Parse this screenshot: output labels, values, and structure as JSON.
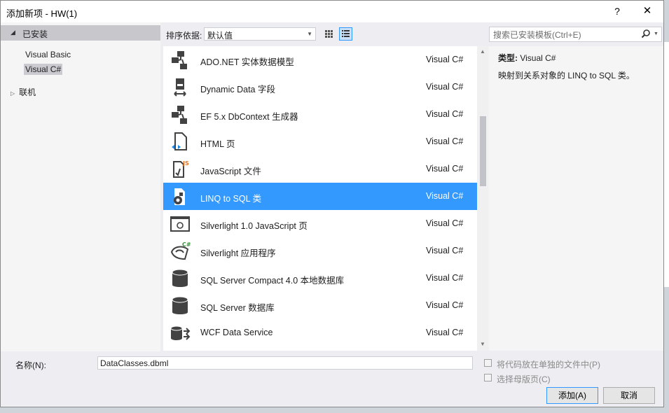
{
  "dialog": {
    "title": "添加新项 - HW(1)",
    "help_glyph": "?",
    "close_glyph": "✕"
  },
  "tree": {
    "installed_label": "已安装",
    "items": [
      {
        "label": "Visual Basic",
        "selected": false
      },
      {
        "label": "Visual C#",
        "selected": true
      }
    ],
    "online_label": "联机"
  },
  "toolbar": {
    "sort_label": "排序依据:",
    "sort_value": "默认值",
    "view_mode": "list"
  },
  "templates": [
    {
      "name": "ADO.NET 实体数据模型",
      "lang": "Visual C#",
      "icon": "ado-net-entity-icon"
    },
    {
      "name": "Dynamic Data 字段",
      "lang": "Visual C#",
      "icon": "dynamic-data-field-icon"
    },
    {
      "name": "EF 5.x DbContext 生成器",
      "lang": "Visual C#",
      "icon": "ef-dbcontext-icon"
    },
    {
      "name": "HTML 页",
      "lang": "Visual C#",
      "icon": "html-page-icon"
    },
    {
      "name": "JavaScript 文件",
      "lang": "Visual C#",
      "icon": "javascript-file-icon"
    },
    {
      "name": "LINQ to SQL 类",
      "lang": "Visual C#",
      "icon": "linq-to-sql-icon",
      "selected": true
    },
    {
      "name": "Silverlight 1.0 JavaScript 页",
      "lang": "Visual C#",
      "icon": "silverlight-js-page-icon"
    },
    {
      "name": "Silverlight 应用程序",
      "lang": "Visual C#",
      "icon": "silverlight-app-icon"
    },
    {
      "name": "SQL Server Compact 4.0 本地数据库",
      "lang": "Visual C#",
      "icon": "database-icon"
    },
    {
      "name": "SQL Server 数据库",
      "lang": "Visual C#",
      "icon": "database-icon"
    },
    {
      "name": "WCF Data Service",
      "lang": "Visual C#",
      "icon": "wcf-data-service-icon"
    }
  ],
  "search": {
    "placeholder": "搜索已安装模板(Ctrl+E)"
  },
  "info": {
    "type_label": "类型:",
    "type_value": "Visual C#",
    "description": "映射到关系对象的 LINQ to SQL 类。"
  },
  "bottom": {
    "name_label": "名称(N):",
    "name_value": "DataClasses.dbml",
    "option1": "将代码放在单独的文件中(P)",
    "option2": "选择母版页(C)",
    "add_button": "添加(A)",
    "cancel_button": "取消"
  },
  "colors": {
    "selection": "#3399ff",
    "dialog_bg": "#eeeef2"
  }
}
